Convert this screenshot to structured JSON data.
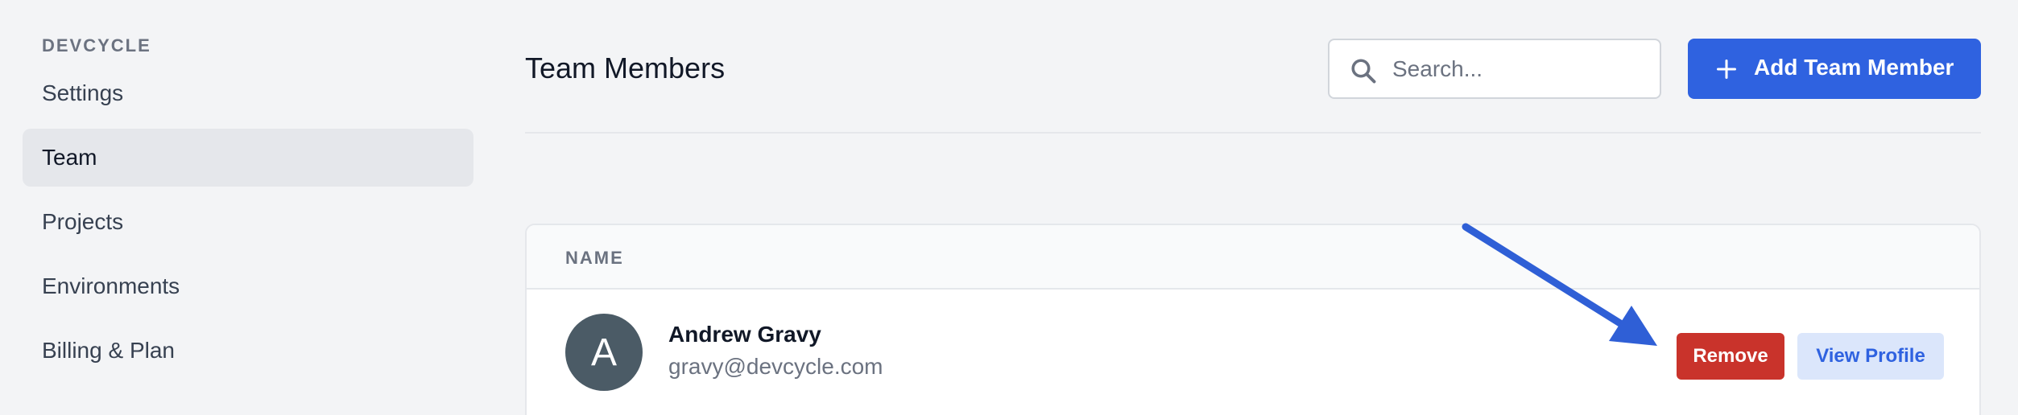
{
  "sidebar": {
    "org_label": "DEVCYCLE",
    "items": [
      {
        "label": "Settings",
        "active": false
      },
      {
        "label": "Team",
        "active": true
      },
      {
        "label": "Projects",
        "active": false
      },
      {
        "label": "Environments",
        "active": false
      },
      {
        "label": "Billing & Plan",
        "active": false
      }
    ]
  },
  "header": {
    "title": "Team Members",
    "search_placeholder": "Search...",
    "add_button_label": "Add Team Member"
  },
  "table": {
    "columns": [
      "NAME"
    ],
    "rows": [
      {
        "avatar_initial": "A",
        "name": "Andrew Gravy",
        "email": "gravy@devcycle.com",
        "remove_label": "Remove",
        "view_label": "View Profile"
      }
    ]
  },
  "colors": {
    "primary": "#2f62e0",
    "danger": "#c9332b",
    "avatar_bg": "#4b5b66",
    "annotation_arrow": "#2f5fd6"
  },
  "icons": {
    "search": "search-icon",
    "add": "plus-icon"
  }
}
